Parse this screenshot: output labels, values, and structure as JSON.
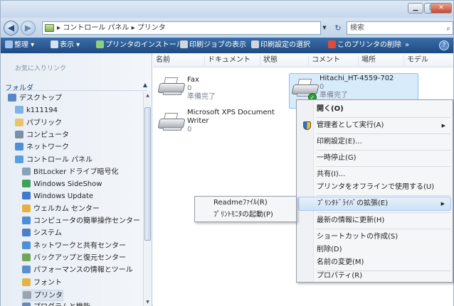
{
  "address": {
    "crumbs": [
      "コントロール パネル",
      "プリンタ"
    ],
    "separator": "▸",
    "search_placeholder": "検索"
  },
  "toolbar": {
    "organize": "整理 ▾",
    "views": "表示 ▾",
    "install": "プリンタのインストール",
    "queue": "印刷ジョブの表示",
    "prefs": "印刷設定の選択",
    "delete": "このプリンタの削除",
    "more": "»"
  },
  "nav": {
    "favorites": "お気に入りリンク",
    "folders": "フォルダ",
    "tree": [
      {
        "label": "デスクトップ",
        "level": 0
      },
      {
        "label": "k111194",
        "level": 1
      },
      {
        "label": "パブリック",
        "level": 1
      },
      {
        "label": "コンピュータ",
        "level": 1
      },
      {
        "label": "ネットワーク",
        "level": 1
      },
      {
        "label": "コントロール パネル",
        "level": 1
      },
      {
        "label": "BitLocker ドライブ暗号化",
        "level": 2
      },
      {
        "label": "Windows SideShow",
        "level": 2
      },
      {
        "label": "Windows Update",
        "level": 2
      },
      {
        "label": "ウェルカム センター",
        "level": 2
      },
      {
        "label": "コンピュータの簡単操作センター",
        "level": 2
      },
      {
        "label": "システム",
        "level": 2
      },
      {
        "label": "ネットワークと共有センター",
        "level": 2
      },
      {
        "label": "バックアップと復元センター",
        "level": 2
      },
      {
        "label": "パフォーマンスの情報とツール",
        "level": 2
      },
      {
        "label": "フォント",
        "level": 2
      },
      {
        "label": "プリンタ",
        "level": 2,
        "selected": true
      },
      {
        "label": "プログラムと機能",
        "level": 2
      }
    ]
  },
  "columns": [
    "名前",
    "ドキュメント",
    "状態",
    "コメント",
    "場所",
    "モデル"
  ],
  "printers": [
    {
      "name": "Fax",
      "docs": "0",
      "status": "準備完了"
    },
    {
      "name": "Microsoft XPS Document",
      "name2": "Writer",
      "docs": "0"
    },
    {
      "name": "Hitachi_HT-4559-702",
      "docs": "0",
      "status": "準備完了"
    }
  ],
  "context_menu": [
    "開く(O)",
    "管理者として実行(A)",
    "印刷設定(E)...",
    "一時停止(G)",
    "共有(I)...",
    "プリンタをオフラインで使用する(U)",
    "ﾌﾟﾘﾝﾀﾄﾞﾗｲﾊﾞの拡張(E)",
    "最新の情報に更新(H)",
    "ショートカットの作成(S)",
    "削除(D)",
    "名前の変更(M)",
    "プロパティ(R)"
  ],
  "submenu": [
    "Readmeﾌｧｲﾙ(R)",
    "ﾌﾟﾘﾝﾄﾓﾆﾀの起動(P)"
  ]
}
